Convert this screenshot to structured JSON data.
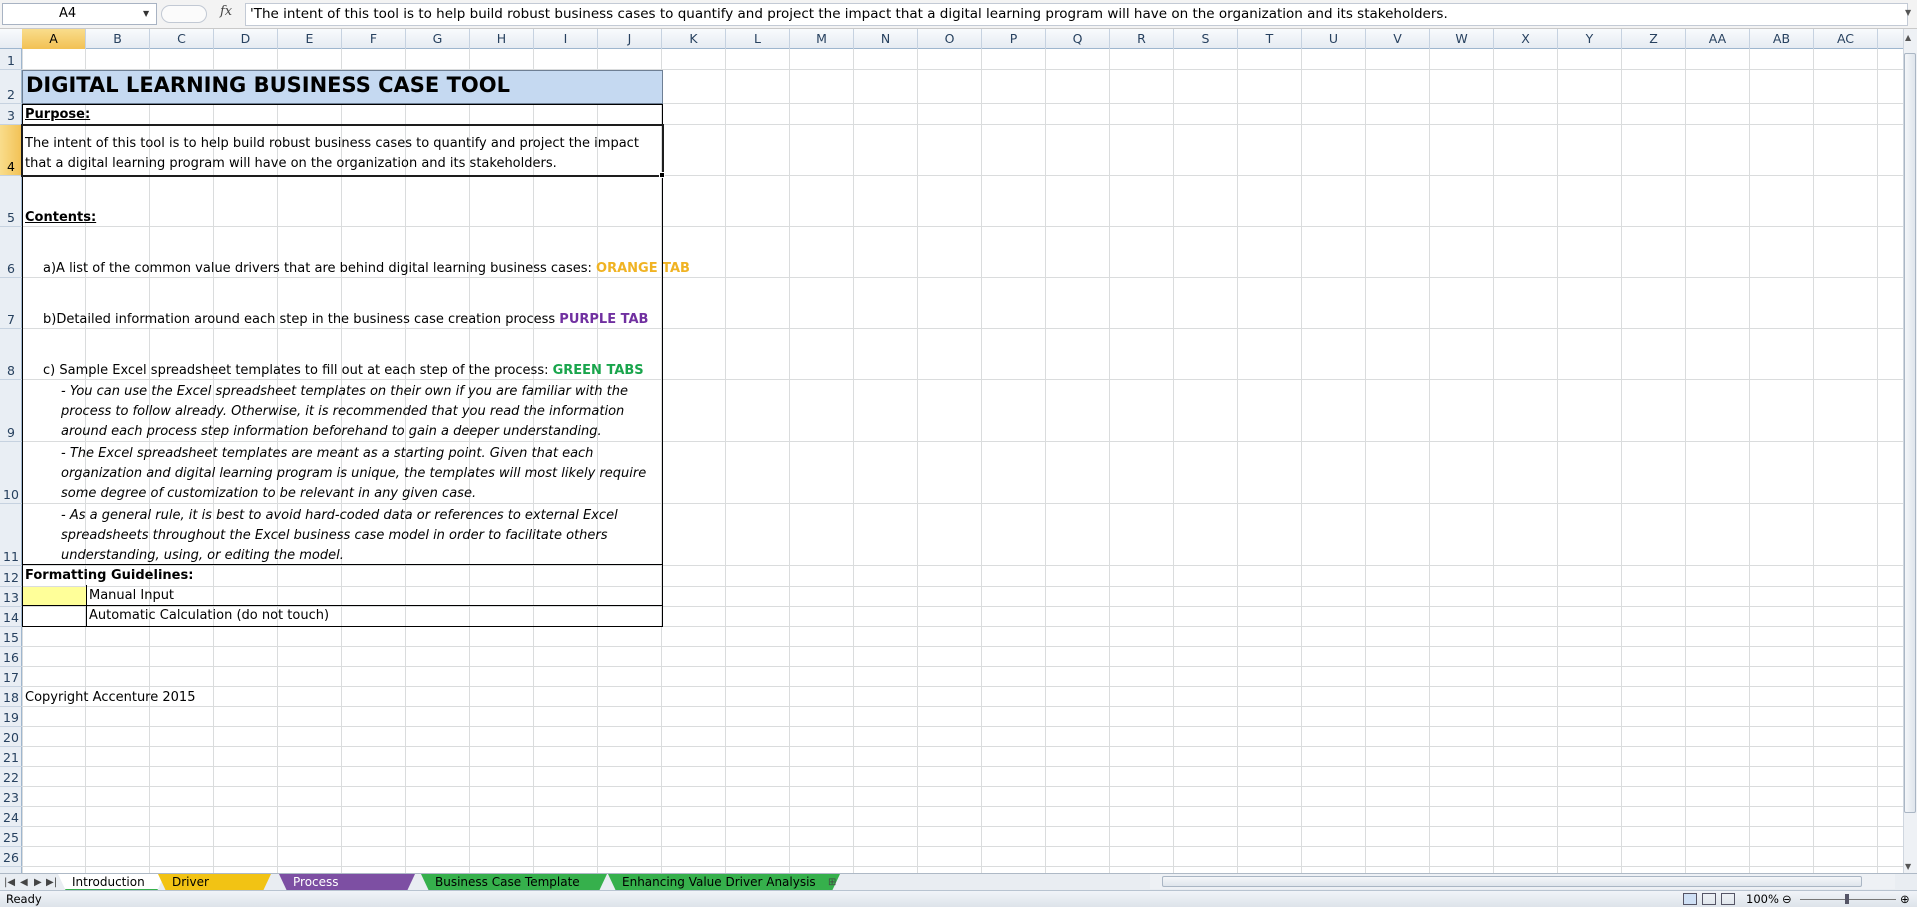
{
  "formula_bar": {
    "name_box": "A4",
    "fx_label": "fx",
    "formula": "'The intent of this tool is to help build robust business cases to quantify and project the impact that a digital learning program will have on the organization and its stakeholders."
  },
  "columns": [
    "A",
    "B",
    "C",
    "D",
    "E",
    "F",
    "G",
    "H",
    "I",
    "J",
    "K",
    "L",
    "M",
    "N",
    "O",
    "P",
    "Q",
    "R",
    "S",
    "T",
    "U",
    "V",
    "W",
    "X",
    "Y",
    "Z",
    "AA",
    "AB",
    "AC"
  ],
  "rows": [
    "1",
    "2",
    "3",
    "4",
    "5",
    "6",
    "7",
    "8",
    "9",
    "10",
    "11",
    "12",
    "13",
    "14",
    "15",
    "16",
    "17",
    "18",
    "19",
    "20",
    "21",
    "22",
    "23",
    "24",
    "25",
    "26"
  ],
  "selected": {
    "column": "A",
    "row": "4"
  },
  "sheet": {
    "title": "DIGITAL LEARNING BUSINESS CASE TOOL",
    "purpose_label": "Purpose:",
    "purpose_text": "The intent of this tool is to help build robust business cases to quantify and project the impact that a digital learning program will have on the organization and its stakeholders.",
    "contents_label": "Contents:",
    "item_a": "a)A list of the common value drivers that are behind digital learning business cases: ",
    "item_a_tag": "ORANGE TAB",
    "item_b": "b)Detailed information around each step in the business case creation process ",
    "item_b_tag": "PURPLE TAB",
    "item_c": "c) Sample Excel spreadsheet templates to fill out at each step of the process: ",
    "item_c_tag": "GREEN TABS",
    "note_1": "- You can use the Excel spreadsheet templates on their own if you are familiar with the process to follow already. Otherwise, it is recommended that you read the information around each process step information beforehand to gain a deeper understanding.",
    "note_2": "- The Excel spreadsheet templates are meant as a starting point. Given that each organization and digital learning program is unique, the templates will most likely require some degree of customization to be relevant in any given case.",
    "note_3": "- As a general rule, it is best to avoid hard-coded data or references to external Excel spreadsheets throughout the Excel business case model in order to facilitate others understanding, using, or editing the model.",
    "formatting_label": "Formatting Guidelines:",
    "manual_input": "Manual Input",
    "auto_calc": "Automatic Calculation (do not touch)",
    "copyright": "Copyright Accenture 2015"
  },
  "colors": {
    "title_bg": "#c5d9f1",
    "orange": "#f0b323",
    "purple": "#7030a0",
    "green": "#19a54c",
    "manual_input_fill": "#ffff99"
  },
  "tabs": [
    {
      "label": "Introduction",
      "color": "#ffffff",
      "text": "#000000",
      "active": true
    },
    {
      "label": "Driver Definitions",
      "color": "#f2c314",
      "text": "#000000",
      "active": false
    },
    {
      "label": "Process Instructions",
      "color": "#7d4fa3",
      "text": "#ffffff",
      "active": false
    },
    {
      "label": "Business Case Template Core",
      "color": "#36b04c",
      "text": "#000000",
      "active": false
    },
    {
      "label": "Enhancing Value Driver Analysis",
      "color": "#36b04c",
      "text": "#000000",
      "active": false
    }
  ],
  "status": {
    "ready": "Ready",
    "zoom": "100%"
  }
}
